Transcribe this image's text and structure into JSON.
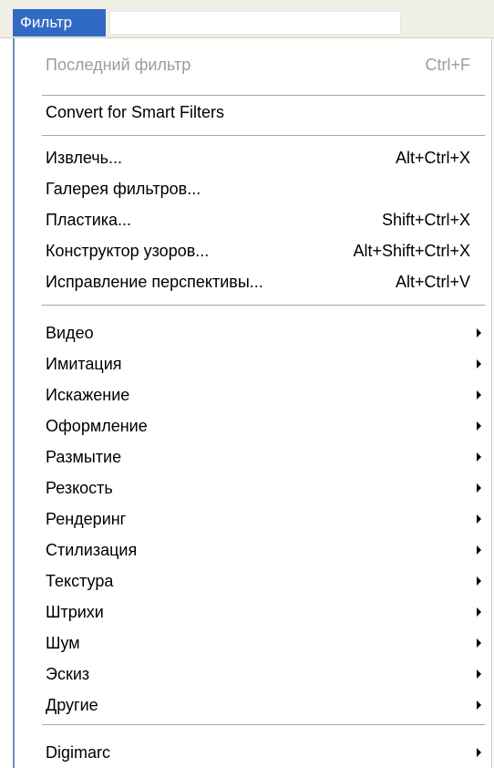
{
  "menubar": {
    "title": "Фильтр"
  },
  "menu": {
    "last_filter": {
      "label": "Последний фильтр",
      "shortcut": "Ctrl+F",
      "disabled": true
    },
    "convert_smart": {
      "label": "Convert for Smart Filters"
    },
    "group1": [
      {
        "label": "Извлечь...",
        "shortcut": "Alt+Ctrl+X"
      },
      {
        "label": "Галерея фильтров...",
        "shortcut": ""
      },
      {
        "label": "Пластика...",
        "shortcut": "Shift+Ctrl+X"
      },
      {
        "label": "Конструктор узоров...",
        "shortcut": "Alt+Shift+Ctrl+X"
      },
      {
        "label": "Исправление перспективы...",
        "shortcut": "Alt+Ctrl+V"
      }
    ],
    "submenus": [
      {
        "label": "Видео"
      },
      {
        "label": "Имитация"
      },
      {
        "label": "Искажение"
      },
      {
        "label": "Оформление"
      },
      {
        "label": "Размытие"
      },
      {
        "label": "Резкость"
      },
      {
        "label": "Рендеринг"
      },
      {
        "label": "Стилизация"
      },
      {
        "label": "Текстура"
      },
      {
        "label": "Штрихи"
      },
      {
        "label": "Шум"
      },
      {
        "label": "Эскиз"
      },
      {
        "label": "Другие"
      }
    ],
    "digimarc": {
      "label": "Digimarc"
    }
  },
  "colors": {
    "highlight": "#316ac5",
    "disabled_text": "#9c9c9c"
  }
}
